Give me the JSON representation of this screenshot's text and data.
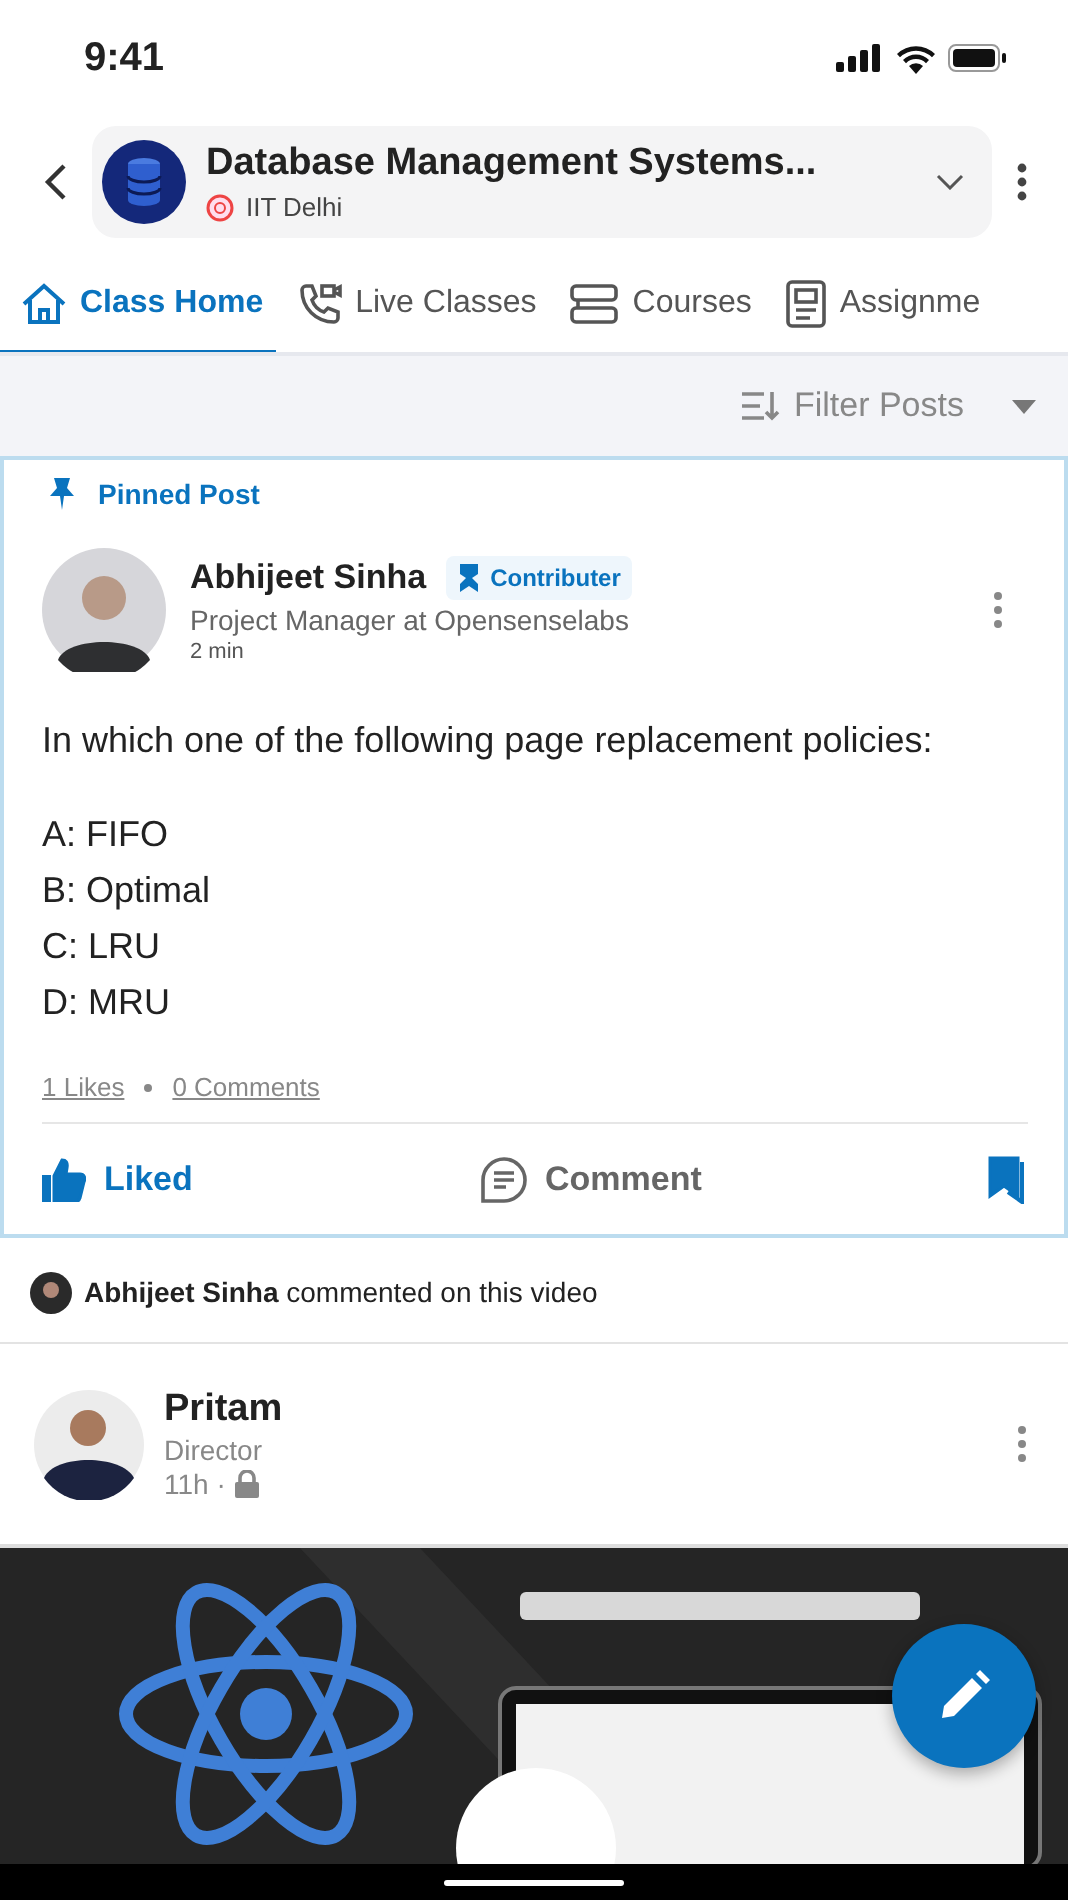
{
  "status_bar": {
    "time": "9:41"
  },
  "header": {
    "title": "Database Management Systems...",
    "subtitle": "IIT Delhi"
  },
  "tabs": [
    {
      "label": "Class Home",
      "kind": "home",
      "selected": true
    },
    {
      "label": "Live Classes",
      "kind": "call",
      "selected": false
    },
    {
      "label": "Courses",
      "kind": "courses",
      "selected": false
    },
    {
      "label": "Assignme",
      "kind": "assignments",
      "selected": false
    }
  ],
  "filter": {
    "label": "Filter Posts"
  },
  "pinned_post": {
    "banner": "Pinned Post",
    "author": "Abhijeet Sinha",
    "badge": "Contributer",
    "role": "Project Manager at Opensenselabs",
    "time": "2 min",
    "question": "In which one of the following page replacement policies:",
    "options": [
      "A: FIFO",
      "B: Optimal",
      "C: LRU",
      "D: MRU"
    ],
    "likes": "1 Likes",
    "comments": "0 Comments",
    "like_label": "Liked",
    "liked": true,
    "comment_label": "Comment",
    "bookmarked": true
  },
  "activity": {
    "actor": "Abhijeet Sinha",
    "text": "commented on this video"
  },
  "video_post": {
    "author": "Pritam",
    "role": "Director",
    "time": "11h ·",
    "private": true
  }
}
